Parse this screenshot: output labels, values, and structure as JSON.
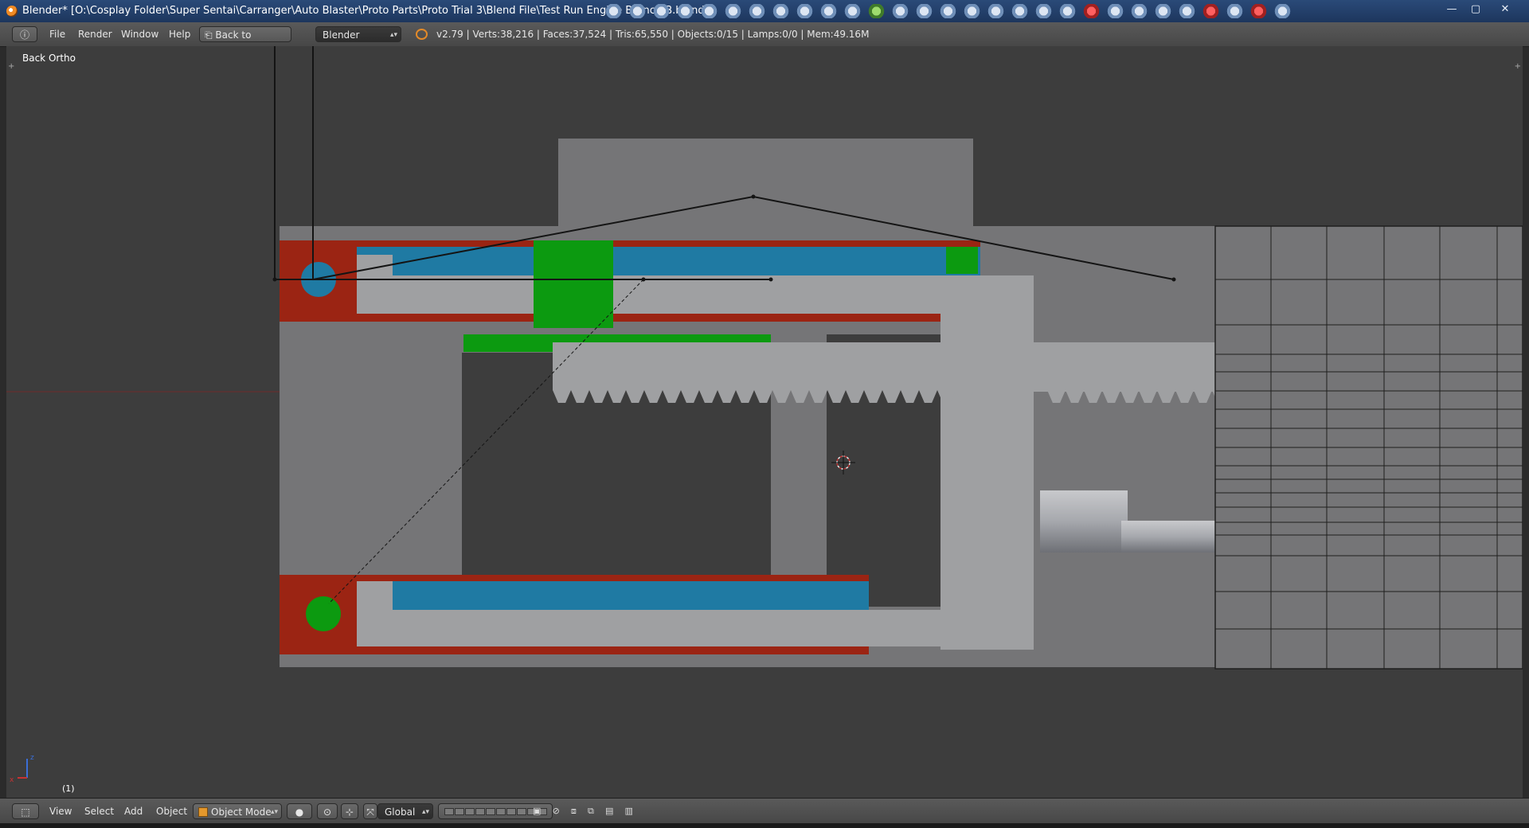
{
  "window": {
    "title": "Blender* [O:\\Cosplay Folder\\Super Sentai\\Carranger\\Auto Blaster\\Proto Parts\\Proto Trial 3\\Blend File\\Test Run Engine Branch B.blend]",
    "min_glyph": "—",
    "max_glyph": "▢",
    "close_glyph": "✕"
  },
  "info_header": {
    "editor_glyph": "ⓘ",
    "menus": {
      "file": "File",
      "render": "Render",
      "window": "Window",
      "help": "Help"
    },
    "back_label": "Back to Previous",
    "engine": "Blender Render",
    "stats": "v2.79 | Verts:38,216 | Faces:37,524 | Tris:65,550 | Objects:0/15 | Lamps:0/0 | Mem:49.16M"
  },
  "viewport": {
    "view_name": "Back Ortho",
    "frame": "(1)",
    "axis_z": "z",
    "axis_x": "x",
    "plus": "+"
  },
  "view3d_header": {
    "editor_glyph": "⬚",
    "menus": {
      "view": "View",
      "select": "Select",
      "add": "Add",
      "object": "Object"
    },
    "mode": "Object Mode",
    "shading_glyph": "●",
    "pivot_glyph": "⊙",
    "manip_glyph": "⊹",
    "orient_glyph": "⤧",
    "orientation": "Global",
    "tool_glyphs": [
      "▣",
      "⊘",
      "⧈",
      "⧉",
      "▤",
      "▥"
    ]
  },
  "colors": {
    "viewport_bg": "#3d3d3d",
    "body_gray": "#757577",
    "light_gray": "#9fa0a2",
    "red_frame": "#9b2413",
    "blue_piston": "#1f7aa3",
    "green_part": "#0c9a10",
    "wire": "#141414"
  }
}
